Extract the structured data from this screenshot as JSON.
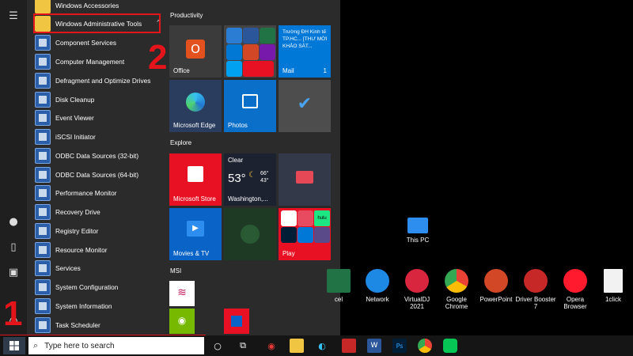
{
  "start_menu": {
    "apps": [
      {
        "label": "Windows Accessories",
        "kind": "folder"
      },
      {
        "label": "Windows Administrative Tools",
        "kind": "folder"
      },
      {
        "label": "Component Services"
      },
      {
        "label": "Computer Management"
      },
      {
        "label": "Defragment and Optimize Drives"
      },
      {
        "label": "Disk Cleanup"
      },
      {
        "label": "Event Viewer"
      },
      {
        "label": "iSCSI Initiator"
      },
      {
        "label": "ODBC Data Sources (32-bit)"
      },
      {
        "label": "ODBC Data Sources (64-bit)"
      },
      {
        "label": "Performance Monitor"
      },
      {
        "label": "Recovery Drive"
      },
      {
        "label": "Registry Editor"
      },
      {
        "label": "Resource Monitor"
      },
      {
        "label": "Services"
      },
      {
        "label": "System Configuration"
      },
      {
        "label": "System Information"
      },
      {
        "label": "Task Scheduler"
      }
    ],
    "groups": {
      "productivity": "Productivity",
      "explore": "Explore",
      "msi": "MSI"
    },
    "tiles": {
      "office": "Office",
      "mail_preview": "Trường ĐH Kinh tế TP.HC... [THƯ MỜI KHẢO SÁT...",
      "mail": "Mail",
      "mail_count": "1",
      "edge": "Microsoft Edge",
      "photos": "Photos",
      "store": "Microsoft Store",
      "weather_cond": "Clear",
      "weather_temp": "53°",
      "weather_hi": "66°",
      "weather_lo": "43°",
      "weather_city": "Washington,...",
      "movies": "Movies & TV",
      "play": "Play",
      "hulu": "hulu"
    }
  },
  "annotations": {
    "step1": "1",
    "step2": "2"
  },
  "taskbar": {
    "search_placeholder": "Type here to search"
  },
  "desktop": {
    "this_pc": "This PC",
    "icons": [
      "cel",
      "Network",
      "VirtualDJ 2021",
      "Google Chrome",
      "PowerPoint",
      "Driver Booster 7",
      "Opera Browser",
      "1click"
    ]
  },
  "colors": {
    "highlight": "#e3151a",
    "accent_blue": "#0078d7",
    "store_red": "#e81123"
  }
}
